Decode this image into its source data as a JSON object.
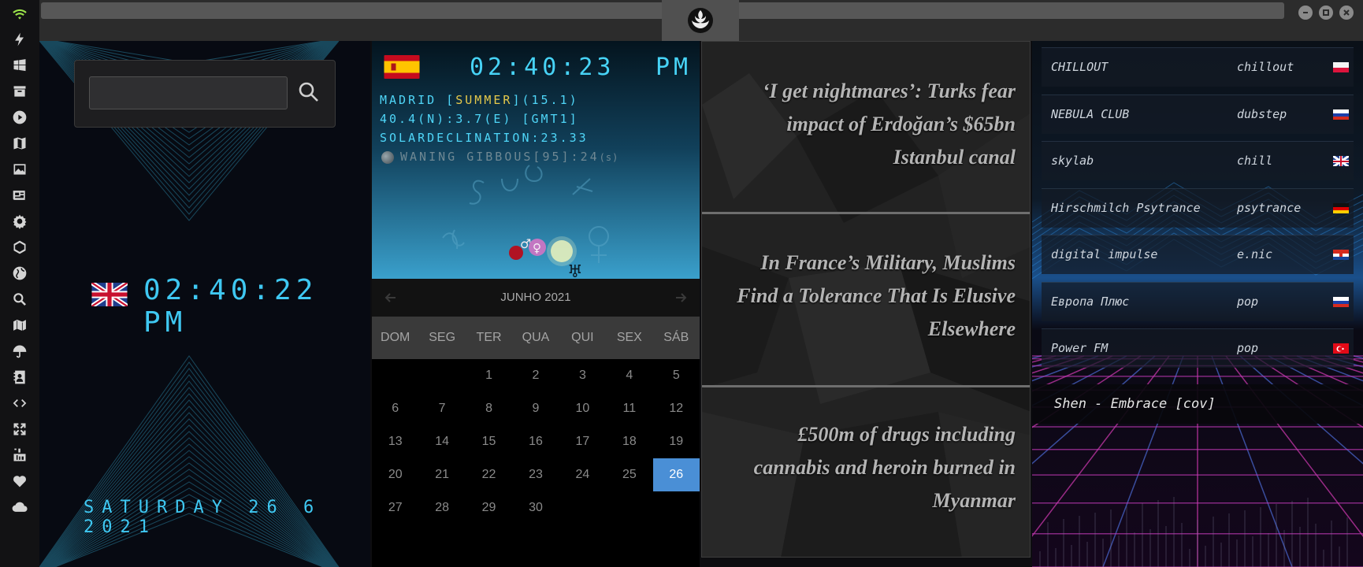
{
  "rail": {
    "icons": [
      "wifi-icon",
      "bolt-icon",
      "windows-icon",
      "archive-icon",
      "play-icon",
      "map-book-icon",
      "image-icon",
      "newspaper-icon",
      "settings-gear-icon",
      "hexagon-icon",
      "globe-icon",
      "search-icon",
      "map-icon",
      "umbrella-icon",
      "contacts-icon",
      "code-icon",
      "expand-icon",
      "youtube-icon",
      "heart-icon",
      "cloud-icon"
    ]
  },
  "titlebar": {
    "logo": "rebel-alliance-icon",
    "buttons": [
      "minimize-icon",
      "maximize-icon",
      "close-icon"
    ]
  },
  "local_clock": {
    "search_placeholder": "",
    "flag": "uk-flag",
    "time": "02:40:22 PM",
    "date": "SATURDAY 26 6 2021"
  },
  "world_clock": {
    "flag": "spain-flag",
    "time": "02:40:23",
    "ampm": "PM",
    "line1_prefix": "MADRID [",
    "line1_season": "SUMMER",
    "line1_suffix": "](15.1)",
    "line2": "40.4(N):3.7(E) [GMT1]",
    "line3": "SOLARDECLINATION:23.33",
    "line4": "WANING GIBBOUS[95]:24",
    "line4_unit": "(s)",
    "planet_symbols": [
      "♂",
      "♀",
      "♅"
    ]
  },
  "calendar": {
    "month": "JUNHO 2021",
    "weekdays": [
      "DOM",
      "SEG",
      "TER",
      "QUA",
      "QUI",
      "SEX",
      "SÁB"
    ],
    "first_weekday_index": 2,
    "days_in_month": 30,
    "today": 26
  },
  "news": {
    "items": [
      "‘I get nightmares’: Turks fear impact of Erdoğan’s $65bn Istanbul canal",
      "In France’s Military, Muslims Find a Tolerance That Is Elusive Elsewhere",
      "£500m of drugs including cannabis and heroin burned in Myanmar"
    ]
  },
  "radio": {
    "stations": [
      {
        "name": "CHILLOUT",
        "genre": "chillout",
        "flag": "poland"
      },
      {
        "name": "NEBULA CLUB",
        "genre": "dubstep",
        "flag": "russia"
      },
      {
        "name": "skylab",
        "genre": "chill",
        "flag": "uk"
      },
      {
        "name": "Hirschmilch Psytrance",
        "genre": "psytrance",
        "flag": "germany"
      },
      {
        "name": "digital impulse",
        "genre": "e.nic",
        "flag": "croatia"
      },
      {
        "name": "Европа Плюс",
        "genre": "pop",
        "flag": "russia"
      },
      {
        "name": "Power FM",
        "genre": "pop",
        "flag": "turkey"
      }
    ],
    "now_playing": "Shen - Embrace [cov]"
  },
  "colors": {
    "lcd": "#3fc8f2",
    "accent_today": "#4a8fd6",
    "summer": "#e4c84b"
  }
}
